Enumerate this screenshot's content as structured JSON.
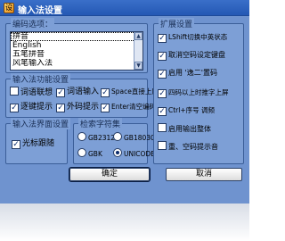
{
  "window": {
    "title": "输入法设置",
    "close_label": "×",
    "icon_glyph": "设"
  },
  "code_select": {
    "label": "编码选项：",
    "items": [
      "拼音",
      "English",
      "五笔拼音",
      "风笔输入法"
    ],
    "selected_index": 0,
    "scroll_up": "▲",
    "scroll_down": "▼"
  },
  "input_features": {
    "label": "输入法功能设置",
    "items": [
      {
        "label": "词语联想",
        "checked": false
      },
      {
        "label": "词语输入",
        "checked": true
      },
      {
        "label": "Space直接上屏",
        "checked": true
      },
      {
        "label": "逐键提示",
        "checked": true
      },
      {
        "label": "外码提示",
        "checked": true
      },
      {
        "label": "Enter清空编码",
        "checked": true
      }
    ]
  },
  "interface": {
    "label": "输入法界面设置",
    "items": [
      {
        "label": "光标跟随",
        "checked": true
      }
    ]
  },
  "charset": {
    "label": "检索字符集",
    "items": [
      {
        "label": "GB2312",
        "checked": false
      },
      {
        "label": "GB18030",
        "checked": false
      },
      {
        "label": "GBK",
        "checked": false
      },
      {
        "label": "UNICODE",
        "checked": true
      }
    ]
  },
  "extension": {
    "label": "扩展设置",
    "items": [
      {
        "label": "LShift切换中英状态",
        "checked": true
      },
      {
        "label": "取消空码设定键盘",
        "checked": true
      },
      {
        "label": "启用 '逸二'置码",
        "checked": true
      },
      {
        "label": "四码以上时推字上屏",
        "checked": true
      },
      {
        "label": "Ctrl+序号 调频",
        "checked": true
      },
      {
        "label": "启用输出整体",
        "checked": false
      },
      {
        "label": "重、空码提示音",
        "checked": false
      }
    ]
  },
  "buttons": {
    "ok": "确定",
    "cancel": "取消"
  }
}
